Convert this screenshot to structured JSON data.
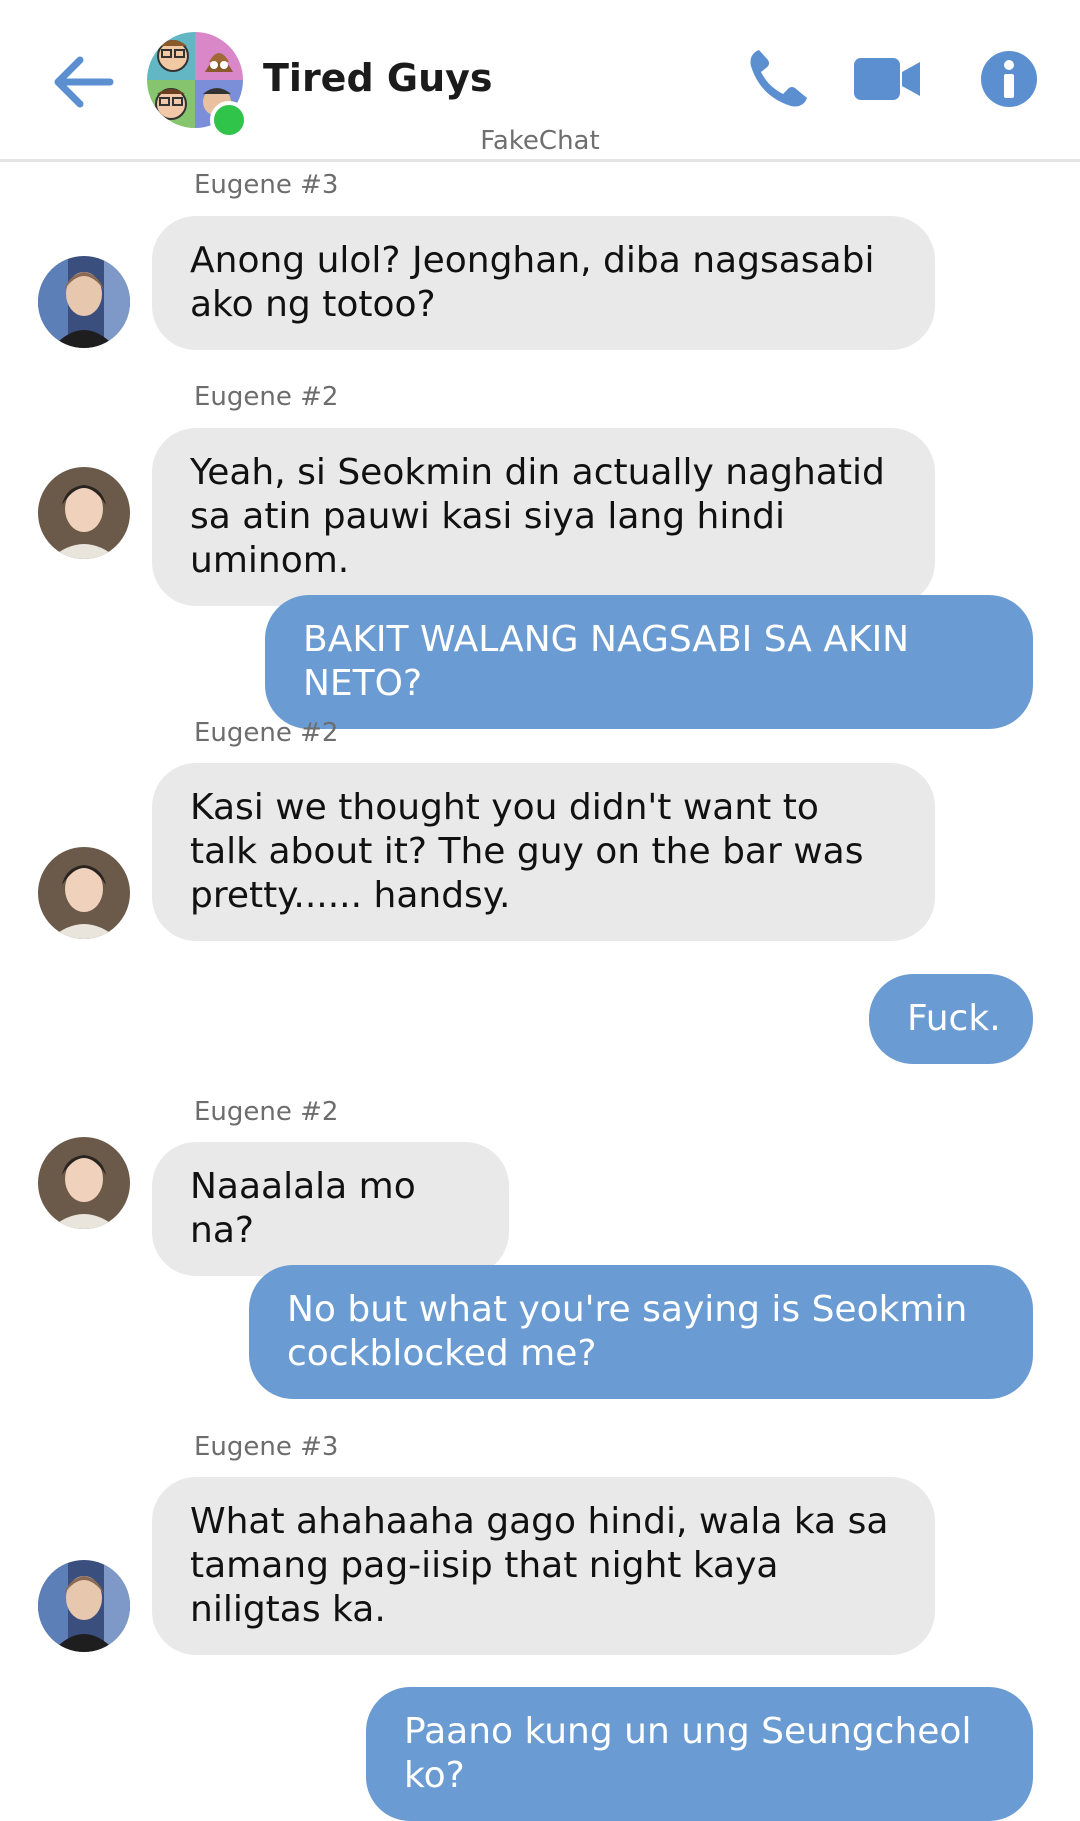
{
  "header": {
    "title": "Tired Guys",
    "watermark": "FakeChat",
    "icons": [
      "back-arrow-icon",
      "phone-icon",
      "video-camera-icon",
      "info-icon"
    ],
    "accent_color": "#5b8fd0",
    "online_color": "#31c44a"
  },
  "colors": {
    "incoming_bubble": "#e9e9e9",
    "outgoing_bubble": "#6a9bd2"
  },
  "messages": [
    {
      "direction": "in",
      "sender": "Eugene #3",
      "text": "Anong ulol? Jeonghan, diba nagsasabi ako ng totoo?"
    },
    {
      "direction": "in",
      "sender": "Eugene #2",
      "text": "Yeah, si Seokmin din actually naghatid sa atin pauwi kasi siya lang hindi uminom."
    },
    {
      "direction": "out",
      "text": "BAKIT WALANG NAGSABI SA AKIN NETO?"
    },
    {
      "direction": "in",
      "sender": "Eugene #2",
      "text": "Kasi we thought you didn't want to talk about it? The guy on the bar was pretty...... handsy."
    },
    {
      "direction": "out",
      "text": "Fuck."
    },
    {
      "direction": "in",
      "sender": "Eugene #2",
      "text": "Naaalala mo na?"
    },
    {
      "direction": "out",
      "text": "No but what you're saying is Seokmin cockblocked me?"
    },
    {
      "direction": "in",
      "sender": "Eugene #3",
      "text": "What ahahaaha gago hindi, wala ka sa tamang pag-iisip that night kaya niligtas ka."
    },
    {
      "direction": "out",
      "text": "Paano kung un ung Seungcheol ko?"
    }
  ]
}
